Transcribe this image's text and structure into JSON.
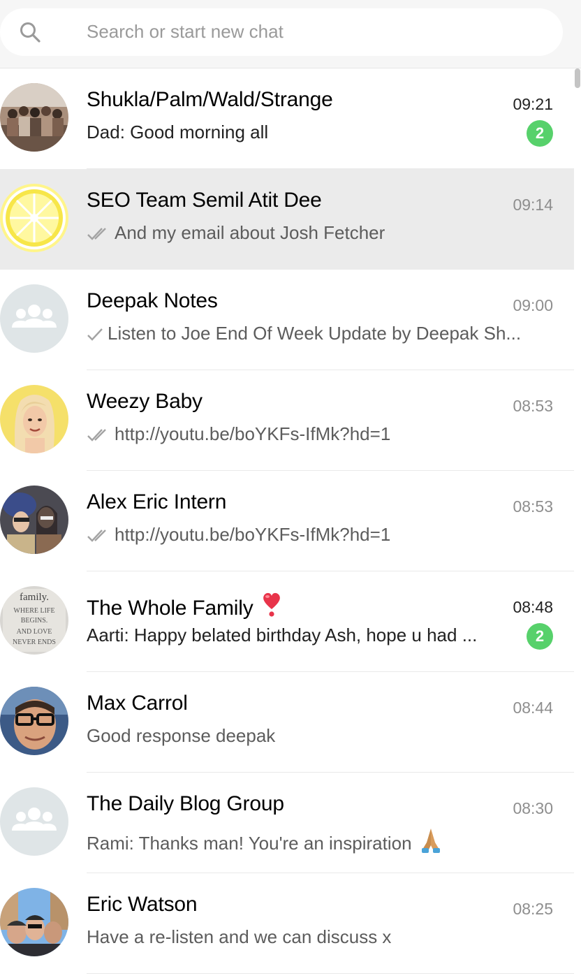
{
  "search": {
    "placeholder": "Search or start new chat",
    "icon": "search-icon"
  },
  "colors": {
    "badge": "#57d16b",
    "selected_row": "#ebebeb",
    "header_bg": "#f6f6f6"
  },
  "chats": [
    {
      "name": "Shukla/Palm/Wald/Strange",
      "time": "09:21",
      "preview": "Dad: Good morning all",
      "unread": "2",
      "avatar": "group-photo-avatar"
    },
    {
      "name": "SEO Team Semil Atit Dee",
      "time": "09:14",
      "preview": "And my email about Josh Fetcher",
      "status": "double-check-icon",
      "selected": true,
      "avatar": "lemon-avatar"
    },
    {
      "name": "Deepak Notes",
      "time": "09:00",
      "preview": "Listen to Joe End Of Week Update by Deepak Sh...",
      "status": "single-check-icon",
      "avatar": "default-group-avatar"
    },
    {
      "name": "Weezy Baby",
      "time": "08:53",
      "preview": "http://youtu.be/boYKFs-IfMk?hd=1",
      "status": "double-check-icon",
      "avatar": "cartoon-portrait-avatar"
    },
    {
      "name": "Alex Eric Intern",
      "time": "08:53",
      "preview": "http://youtu.be/boYKFs-IfMk?hd=1",
      "status": "double-check-icon",
      "avatar": "party-photo-avatar"
    },
    {
      "name": "The Whole Family",
      "time": "08:48",
      "preview": "Aarti: Happy belated birthday Ash, hope u had ...",
      "unread": "2",
      "emoji": "heart-exclamation-emoji",
      "avatar": "family-sign-avatar"
    },
    {
      "name": "Max Carrol",
      "time": "08:44",
      "preview": "Good response deepak",
      "avatar": "man-glasses-avatar"
    },
    {
      "name": "The Daily Blog Group",
      "time": "08:30",
      "preview": "Rami: Thanks man! You're an inspiration",
      "emoji": "folded-hands-emoji",
      "avatar": "default-group-avatar"
    },
    {
      "name": "Eric Watson",
      "time": "08:25",
      "preview": "Have a re-listen and we can discuss x",
      "avatar": "group-selfie-avatar"
    }
  ],
  "avatar_text": {
    "family_sign": [
      "family.",
      "WHERE LIFE",
      "BEGINS.",
      "AND LOVE",
      "NEVER ENDS"
    ]
  }
}
